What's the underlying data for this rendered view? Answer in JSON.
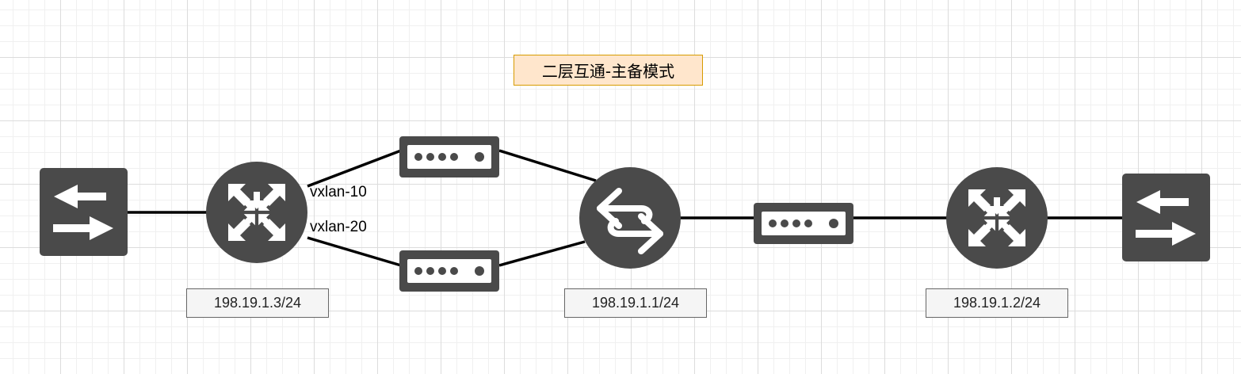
{
  "title": "二层互通-主备模式",
  "links": {
    "vxlan_a": "vxlan-10",
    "vxlan_b": "vxlan-20"
  },
  "devices": {
    "router_left_ip": "198.19.1.3/24",
    "switch_center_ip": "198.19.1.1/24",
    "router_right_ip": "198.19.1.2/24"
  },
  "icons": {
    "switch_left": "switch-icon",
    "router_left": "router-icon",
    "modem_top": "modem-icon",
    "modem_bottom": "modem-icon",
    "switch_center": "l3-switch-icon",
    "modem_right": "modem-icon",
    "router_right": "router-icon",
    "switch_right": "switch-icon"
  },
  "colors": {
    "device": "#4a4a4a",
    "title_fill": "#ffe6cc",
    "title_border": "#d79b00",
    "label_fill": "#f5f5f5",
    "label_border": "#666666"
  }
}
